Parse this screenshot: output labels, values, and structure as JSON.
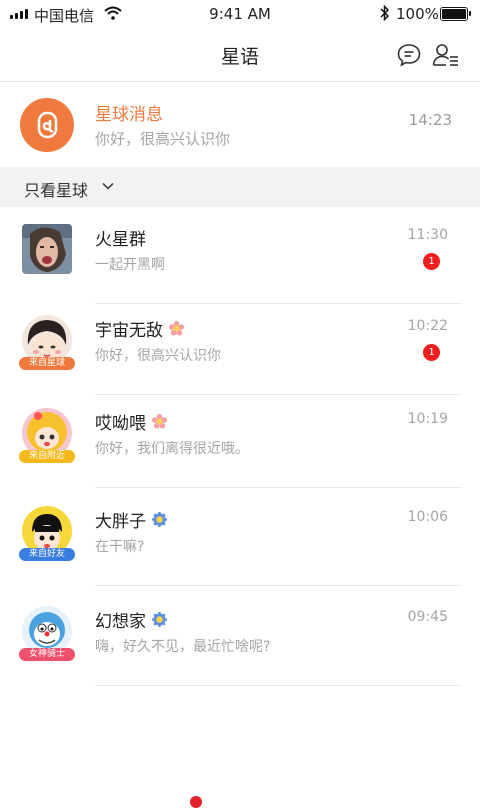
{
  "status_bar": {
    "carrier": "中国电信",
    "time": "9:41 AM",
    "battery": "100%"
  },
  "header": {
    "title": "星语"
  },
  "planet_message": {
    "name": "星球消息",
    "preview": "你好，很高兴认识你",
    "time": "14:23"
  },
  "filter": {
    "label": "只看星球"
  },
  "chats": [
    {
      "name": "火星群",
      "preview": "一起开黑啊",
      "time": "11:30",
      "badge": "1",
      "tag": ""
    },
    {
      "name": "宇宙无敌",
      "preview": "你好，很高兴认识你",
      "time": "10:22",
      "badge": "1",
      "tag": "来自星球",
      "tag_color": "#f07a3e",
      "verify": "flower-pink"
    },
    {
      "name": "哎呦喂",
      "preview": "你好，我们离得很近哦。",
      "time": "10:19",
      "badge": "",
      "tag": "来自附近",
      "tag_color": "#f5b81c",
      "verify": "flower-pink"
    },
    {
      "name": "大胖子",
      "preview": "在干嘛?",
      "time": "10:06",
      "badge": "",
      "tag": "来自好友",
      "tag_color": "#3a7de0",
      "verify": "gear-blue"
    },
    {
      "name": "幻想家",
      "preview": "嗨，好久不见，最近忙啥呢?",
      "time": "09:45",
      "badge": "",
      "tag": "女神骑士",
      "tag_color": "#f0506e",
      "verify": "gear-blue"
    }
  ],
  "colors": {
    "accent": "#f07a3e",
    "badge": "#f01e1e",
    "muted": "#a5a5a5"
  }
}
